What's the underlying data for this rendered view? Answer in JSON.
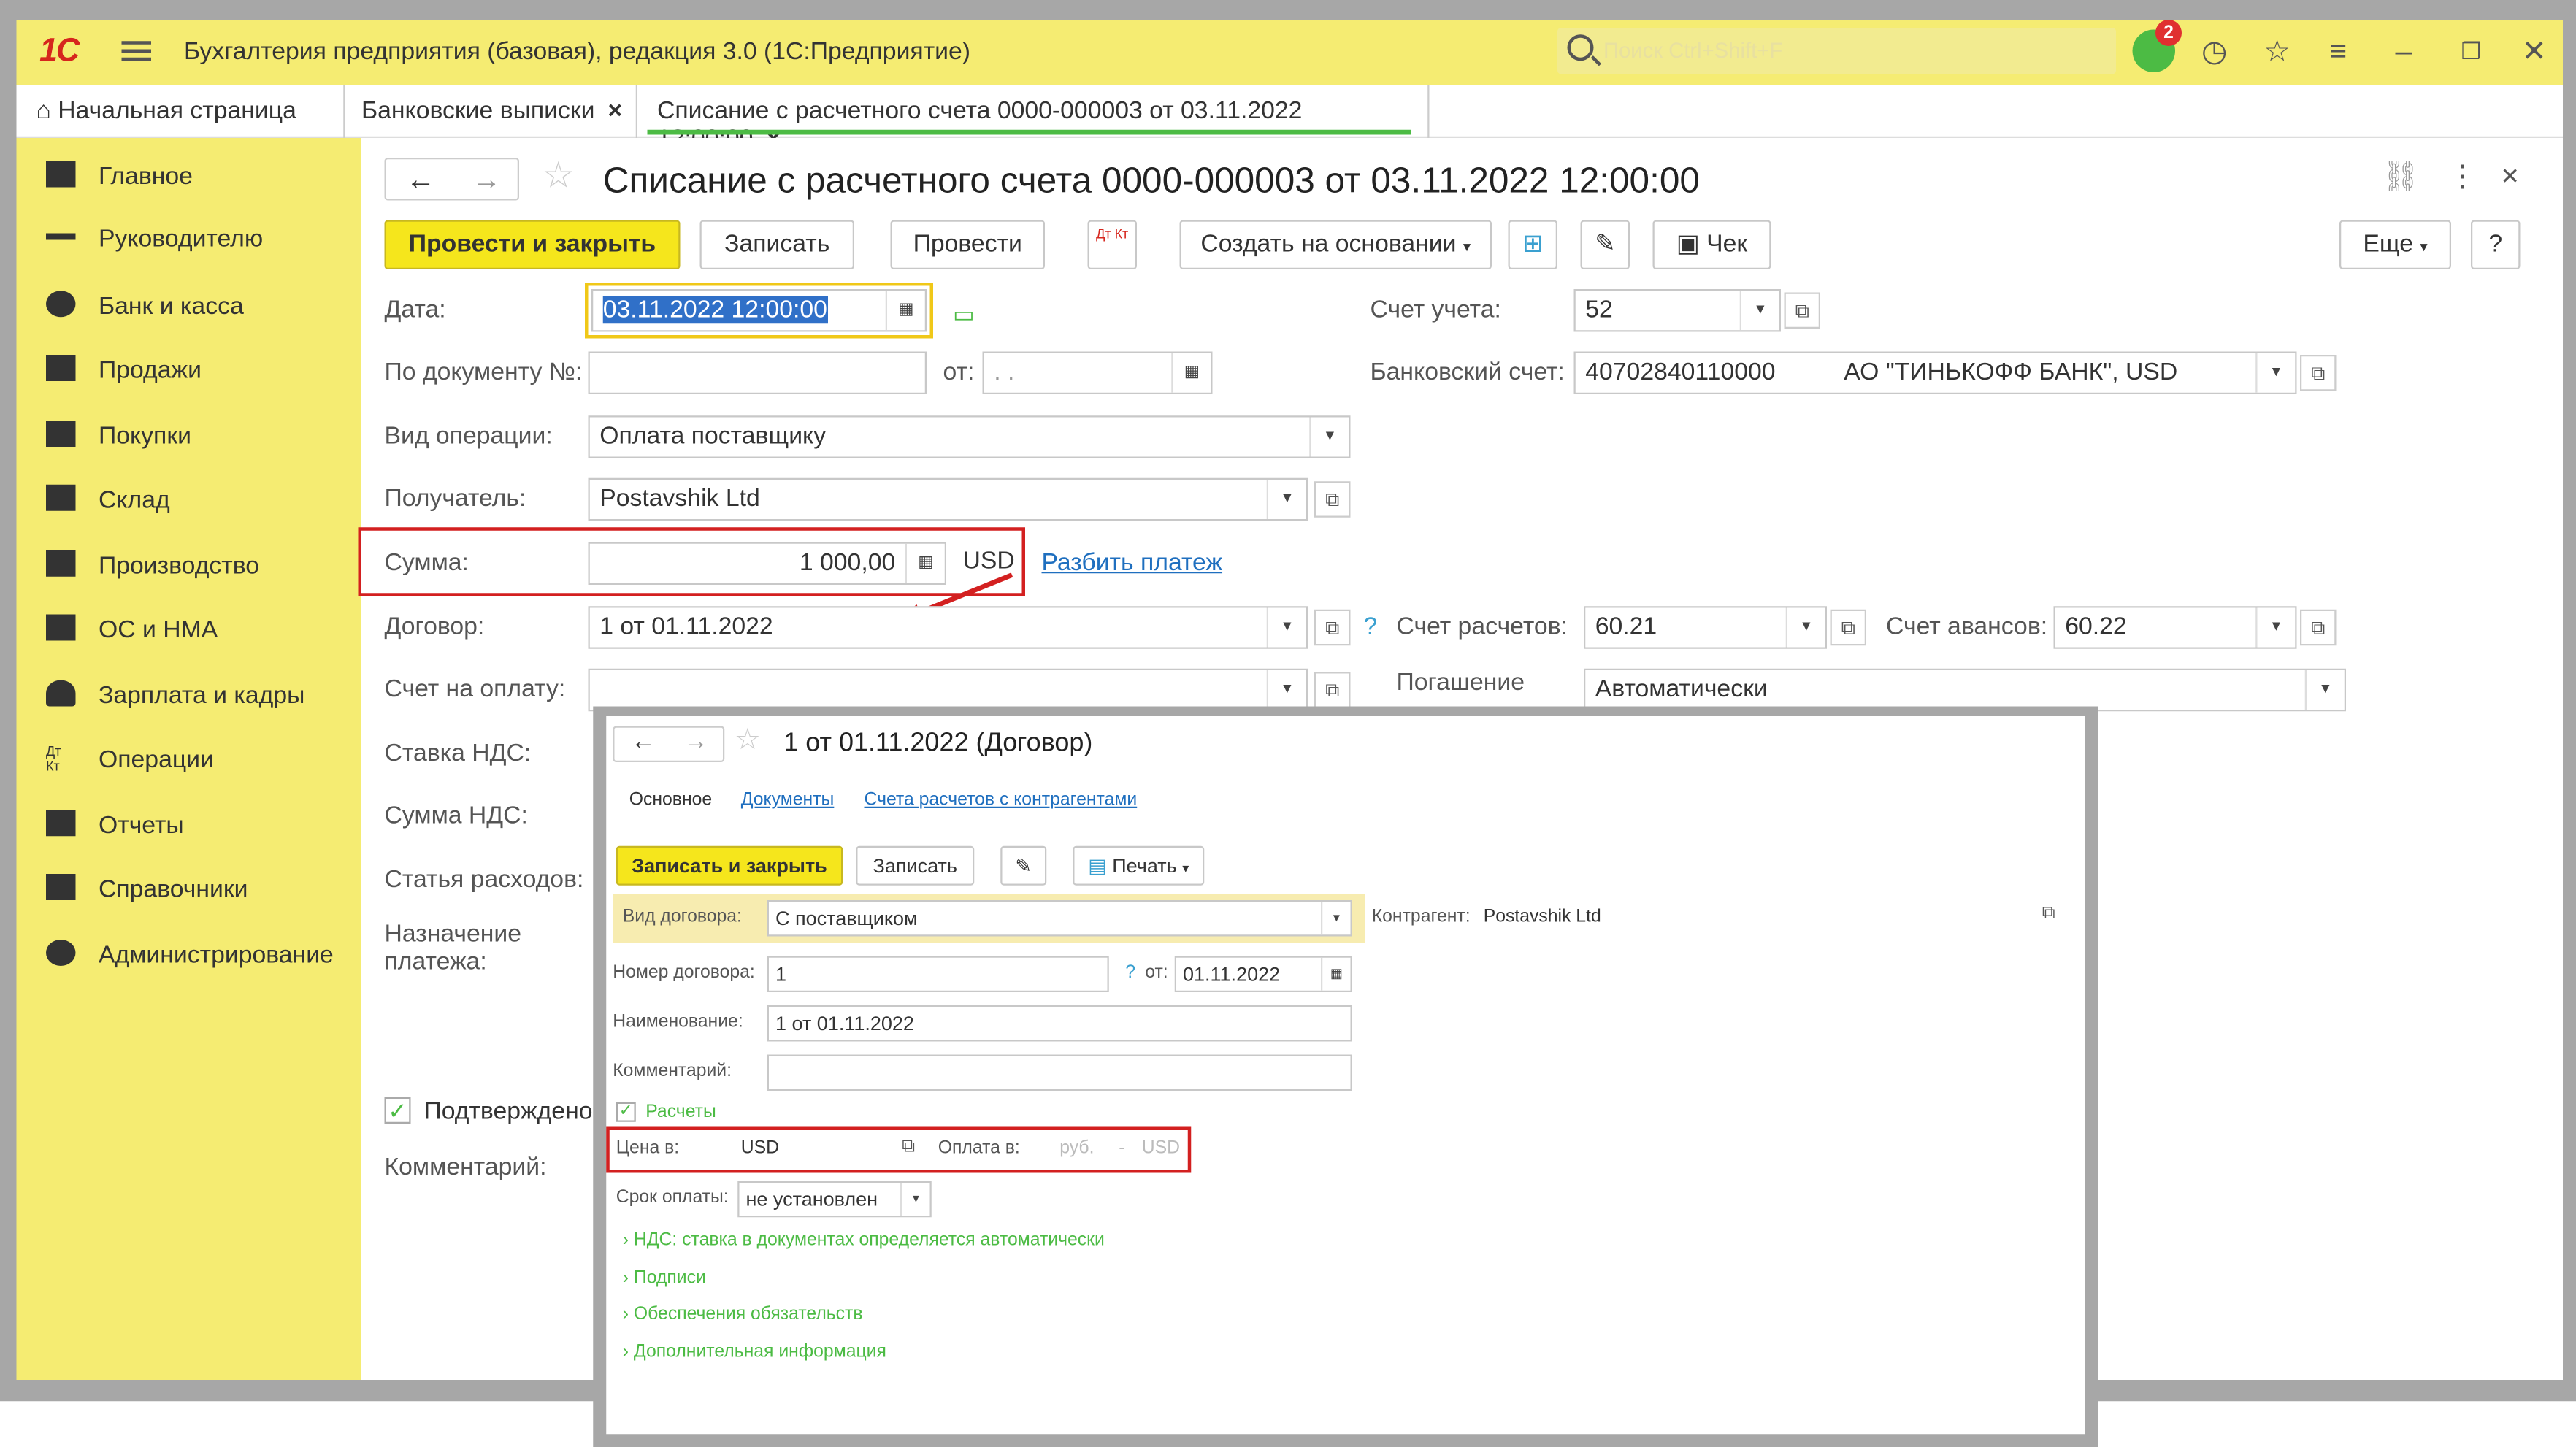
{
  "app": {
    "logo": "1С",
    "title": "Бухгалтерия предприятия (базовая), редакция 3.0  (1С:Предприятие)",
    "search_placeholder": "Поиск Ctrl+Shift+F",
    "notifications": "2"
  },
  "tabs": [
    {
      "label": "Начальная страница"
    },
    {
      "label": "Банковские выписки",
      "close": "×"
    },
    {
      "label": "Списание с расчетного счета 0000-000003 от 03.11.2022 12:00:00",
      "close": "×"
    }
  ],
  "sidebar": [
    "Главное",
    "Руководителю",
    "Банк и касса",
    "Продажи",
    "Покупки",
    "Склад",
    "Производство",
    "ОС и НМА",
    "Зарплата и кадры",
    "Операции",
    "Отчеты",
    "Справочники",
    "Администрирование"
  ],
  "doc": {
    "title": "Списание с расчетного счета 0000-000003 от 03.11.2022 12:00:00",
    "buttons": {
      "post_close": "Провести и закрыть",
      "save": "Записать",
      "post": "Провести",
      "dtkt": "Дт Кт",
      "create_based": "Создать на основании",
      "check": "Чек",
      "more": "Еще",
      "help": "?"
    },
    "date_label": "Дата:",
    "date_value": "03.11.2022 12:00:00",
    "docnum_label": "По документу №:",
    "docnum_value": "",
    "from_label": "от:",
    "from_value": " .  .",
    "optype_label": "Вид операции:",
    "optype_value": "Оплата поставщику",
    "recipient_label": "Получатель:",
    "recipient_value": "Postavshik Ltd",
    "sum_label": "Сумма:",
    "sum_value": "1 000,00",
    "sum_currency": "USD",
    "split_link": "Разбить платеж",
    "contract_label": "Договор:",
    "contract_value": "1 от 01.11.2022",
    "invoice_label": "Счет на оплату:",
    "invoice_value": "",
    "vat_rate_label": "Ставка НДС:",
    "vat_sum_label": "Сумма НДС:",
    "expense_label": "Статья расходов:",
    "purpose_label": "Назначение платежа:",
    "confirmed_label": "Подтверждено",
    "comment_label": "Комментарий:",
    "account_label": "Счет учета:",
    "account_value": "52",
    "bank_label": "Банковский счет:",
    "bank_value": "40702840110000          АО \"ТИНЬКОФФ БАНК\", USD",
    "settle_q": "?",
    "settle_label": "Счет расчетов:",
    "settle_value": "60.21",
    "advance_label": "Счет авансов:",
    "advance_value": "60.22",
    "repay_label": "Погашение",
    "repay_value": "Автоматически"
  },
  "popup": {
    "title": "1 от 01.11.2022 (Договор)",
    "tabs": [
      "Основное",
      "Документы",
      "Счета расчетов с контрагентами"
    ],
    "buttons": {
      "save_close": "Записать и закрыть",
      "save": "Записать",
      "print": "Печать"
    },
    "type_label": "Вид договора:",
    "type_value": "С поставщиком",
    "partner_label": "Контрагент:",
    "partner_value": "Postavshik Ltd",
    "num_label": "Номер договора:",
    "num_value": "1",
    "q": "?",
    "from_label": "от:",
    "from_value": "01.11.2022",
    "name_label": "Наименование:",
    "name_value": "1 от 01.11.2022",
    "comment_label": "Комментарий:",
    "settlements": "Расчеты",
    "price_label": "Цена в:",
    "price_value": "USD",
    "pay_label": "Оплата в:",
    "pay_rub": "руб.",
    "pay_sep": "-",
    "pay_usd": "USD",
    "term_label": "Срок оплаты:",
    "term_value": "не установлен",
    "sections": [
      "НДС: ставка в документах определяется автоматически",
      "Подписи",
      "Обеспечения обязательств",
      "Дополнительная информация"
    ]
  }
}
